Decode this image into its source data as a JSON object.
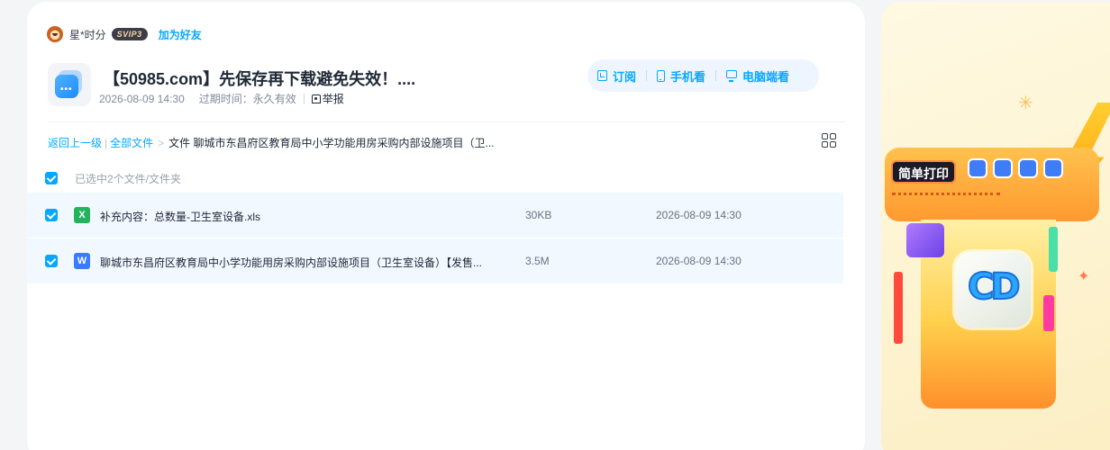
{
  "owner": {
    "name": "星*时分",
    "vip_badge": "SVIP3",
    "add_friend_label": "加为好友"
  },
  "share": {
    "title": "【50985.com】先保存再下载避免失效！....",
    "date": "2026-08-09 14:30",
    "expire_label": "过期时间：永久有效",
    "report_label": "举报"
  },
  "view_options": {
    "subscribe": "订阅",
    "mobile": "手机看",
    "desktop": "电脑端看"
  },
  "breadcrumb": {
    "back": "返回上一级",
    "all_files": "全部文件",
    "current": "文件 聊城市东昌府区教育局中小学功能用房采购内部设施项目（卫..."
  },
  "selection": {
    "summary": "已选中2个文件/文件夹"
  },
  "files": [
    {
      "icon": "xls-file-icon",
      "icon_glyph": "X",
      "name": "补充内容：总数量-卫生室设备.xls",
      "size": "30KB",
      "date": "2026-08-09 14:30"
    },
    {
      "icon": "word-file-icon",
      "icon_glyph": "W",
      "name": "聊城市东昌府区教育局中小学功能用房采购内部设施项目（卫生室设备）【发售...",
      "size": "3.5M",
      "date": "2026-08-09 14:30"
    }
  ],
  "ad": {
    "title": "简单打印"
  },
  "colors": {
    "accent": "#06a7ff",
    "selected_row": "#f1f8ff",
    "xls": "#23b35f",
    "doc": "#3a7bff"
  }
}
